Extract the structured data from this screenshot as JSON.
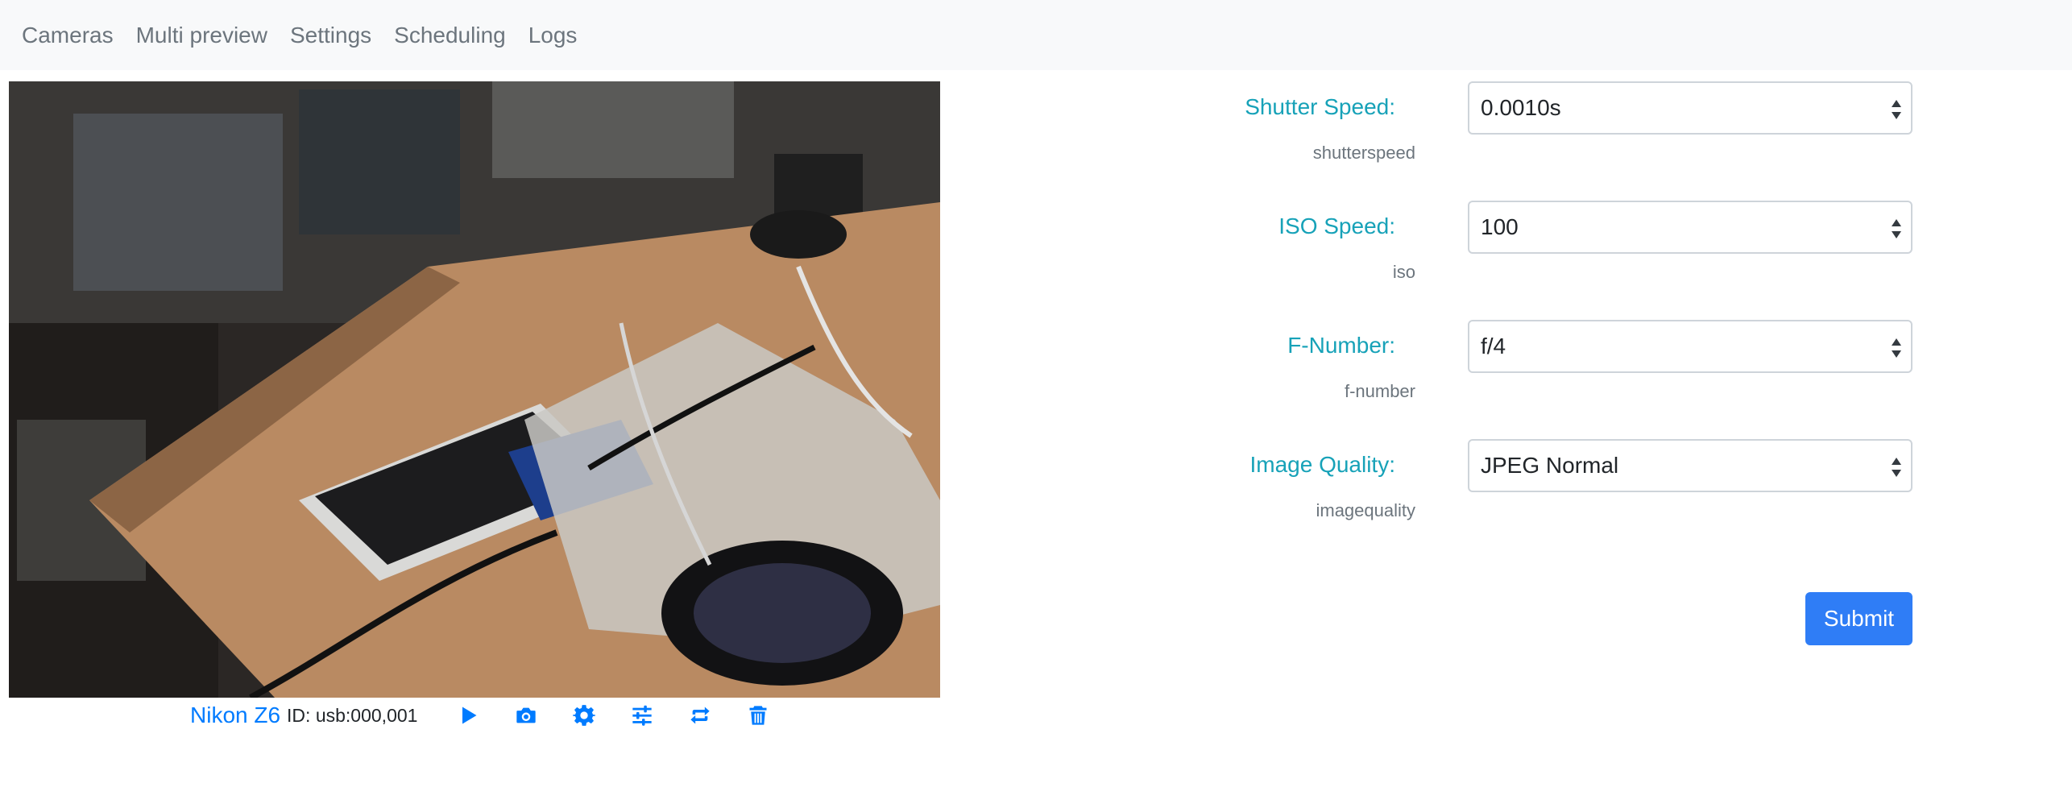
{
  "nav": {
    "items": [
      {
        "label": "Cameras"
      },
      {
        "label": "Multi preview"
      },
      {
        "label": "Settings"
      },
      {
        "label": "Scheduling"
      },
      {
        "label": "Logs"
      }
    ]
  },
  "camera": {
    "name": "Nikon Z6",
    "id_text": "ID: usb:000,001",
    "actions": [
      "play-icon",
      "camera-icon",
      "gear-icon",
      "sliders-icon",
      "repeat-icon",
      "trash-icon"
    ]
  },
  "settings": {
    "fields": [
      {
        "label": "Shutter Speed:",
        "hint": "shutterspeed",
        "value": "0.0010s"
      },
      {
        "label": "ISO Speed:",
        "hint": "iso",
        "value": "100"
      },
      {
        "label": "F-Number:",
        "hint": "f-number",
        "value": "f/4"
      },
      {
        "label": "Image Quality:",
        "hint": "imagequality",
        "value": "JPEG Normal"
      }
    ],
    "submit_label": "Submit"
  },
  "colors": {
    "accent": "#007bff",
    "label": "#17a2b8",
    "button": "#2f7df6"
  }
}
